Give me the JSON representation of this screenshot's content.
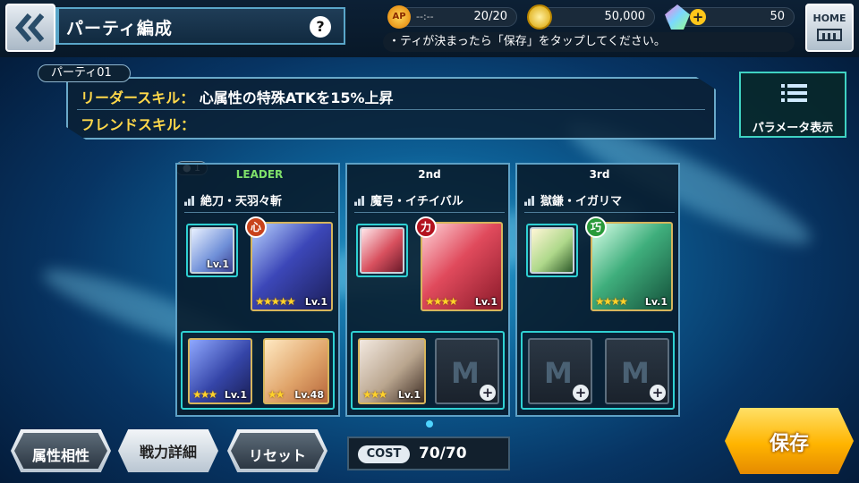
{
  "header": {
    "title": "パーティ編成",
    "help_label": "?",
    "ap_icon_label": "AP",
    "ap_timer": "--:--",
    "ap": "20/20",
    "gold": "50,000",
    "gems": "50",
    "gem_plus": "+",
    "hint": "・ティが決まったら「保存」をタップしてください。",
    "home_label": "HOME"
  },
  "party": {
    "name": "パーティ01",
    "leader_skill_label": "リーダースキル：",
    "leader_skill_value": "心属性の特殊ATKを15%上昇",
    "friend_skill_label": "フレンドスキル：",
    "friend_skill_value": "",
    "param_button": "パラメータ表示",
    "team_count": "1"
  },
  "members": [
    {
      "slot": "LEADER",
      "name": "絶刀・天羽々斬",
      "attribute": "心",
      "main": {
        "level": "Lv.1",
        "stars": "★★★★★"
      },
      "support": {
        "level": "Lv.1"
      },
      "subs": [
        {
          "level": "Lv.1",
          "stars": "★★★"
        },
        {
          "level": "Lv.48",
          "stars": "★★"
        }
      ]
    },
    {
      "slot": "2nd",
      "name": "魔弓・イチイバル",
      "attribute": "力",
      "main": {
        "level": "Lv.1",
        "stars": "★★★★"
      },
      "support": {
        "level": ""
      },
      "subs": [
        {
          "level": "Lv.1",
          "stars": "★★★"
        }
      ]
    },
    {
      "slot": "3rd",
      "name": "獄鎌・イガリマ",
      "attribute": "巧",
      "main": {
        "level": "Lv.1",
        "stars": "★★★★"
      },
      "support": {
        "level": ""
      },
      "subs": []
    }
  ],
  "empty_slot": {
    "add": "+",
    "emblem": "M"
  },
  "footer": {
    "attribute_btn": "属性相性",
    "power_btn": "戦力詳細",
    "reset_btn": "リセット",
    "cost_label": "COST",
    "cost_value": "70/70",
    "save_btn": "保存"
  }
}
